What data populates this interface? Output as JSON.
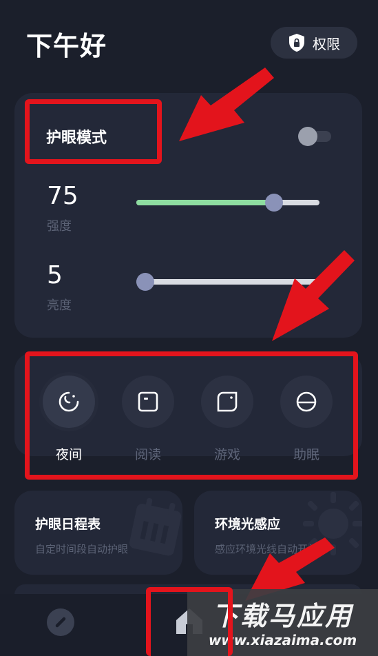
{
  "header": {
    "greeting": "下午好",
    "permission_label": "权限"
  },
  "eye_mode": {
    "title": "护眼模式",
    "enabled": false,
    "strength": {
      "value": "75",
      "label": "强度",
      "level": 75
    },
    "brightness": {
      "value": "5",
      "label": "亮度",
      "level": 5
    }
  },
  "modes": [
    {
      "label": "夜间",
      "icon": "moon-icon",
      "active": true
    },
    {
      "label": "阅读",
      "icon": "book-icon",
      "active": false
    },
    {
      "label": "游戏",
      "icon": "game-icon",
      "active": false
    },
    {
      "label": "助眠",
      "icon": "sleep-icon",
      "active": false
    }
  ],
  "cards": {
    "schedule": {
      "title": "护眼日程表",
      "subtitle": "自定时间段自动护眼"
    },
    "ambient": {
      "title": "环境光感应",
      "subtitle": "感应环境光线自动开关"
    }
  },
  "watermark": {
    "title": "下载马应用",
    "subtitle": "www.xiazaima.com"
  },
  "colors": {
    "background": "#1b1f2b",
    "card": "#232838",
    "slider_fill": "#8edda0",
    "slider_thumb": "#8a92b8",
    "annotation_red": "#e3141c"
  }
}
